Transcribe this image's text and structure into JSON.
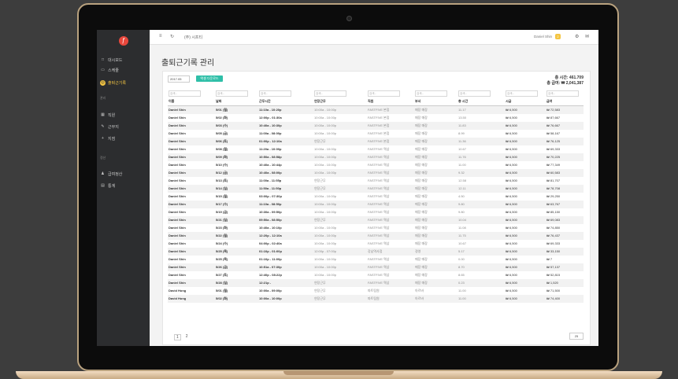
{
  "sidebar": {
    "items": [
      {
        "icon": "□",
        "label": "대시보드"
      },
      {
        "icon": "▭",
        "label": "스케줄"
      },
      {
        "icon": "◎",
        "label": "출퇴근기록"
      }
    ],
    "section1": "관리",
    "items2": [
      {
        "icon": "▦",
        "label": "직원"
      },
      {
        "icon": "✎",
        "label": "근무지"
      },
      {
        "icon": "+",
        "label": "지점"
      }
    ],
    "section2": "정산",
    "items3": [
      {
        "icon": "♟",
        "label": "급여정산"
      },
      {
        "icon": "▤",
        "label": "통계"
      }
    ]
  },
  "topbar": {
    "brand": "(주) 시프티",
    "user": "Daniel Shin",
    "badge": "2"
  },
  "page": {
    "title": "출퇴근기록 관리"
  },
  "toolbar": {
    "month": "2017.05",
    "button": "엑셀 다운로드"
  },
  "summary": {
    "line1": "총 시간: 461.709",
    "line2": "총 급여: ₩ 2,041,387"
  },
  "table": {
    "filter_placeholder": "검색...",
    "headers": [
      "이름",
      "날짜",
      "근무시간",
      "연장근무",
      "직원",
      "부서",
      "총 시간",
      "시급",
      "급여"
    ],
    "rows": [
      [
        "Daniel Shin",
        "5/01 (월)",
        "11:10a - 10:20p",
        "10:00a - 10:00p",
        "FASTFIVE 본점",
        "매장 매장",
        "11.17",
        "₩ 6,500",
        "₩ 72,583"
      ],
      [
        "Daniel Shin",
        "5/02 (화)",
        "12:00p - 01:30a",
        "10:00a - 10:00p",
        "FASTFIVE 본점",
        "매장 매장",
        "13.50",
        "₩ 6,500",
        "₩ 87,667"
      ],
      [
        "Daniel Shin",
        "5/03 (수)",
        "10:40a - 10:30p",
        "10:00a - 10:00p",
        "FASTFIVE 본점",
        "매장 매장",
        "11.83",
        "₩ 6,500",
        "₩ 76,667"
      ],
      [
        "Daniel Shin",
        "5/05 (금)",
        "11:00a - 08:00p",
        "10:00a - 10:00p",
        "FASTFIVE 본점",
        "매장 매장",
        "8.99",
        "₩ 6,500",
        "₩ 58,167"
      ],
      [
        "Daniel Shin",
        "5/06 (토)",
        "01:00p - 12:10a",
        "연장근무",
        "FASTFIVE 본점",
        "매장 매장",
        "11.36",
        "₩ 6,500",
        "₩ 76,125"
      ],
      [
        "Daniel Shin",
        "5/08 (월)",
        "11:20a - 10:00p",
        "10:00a - 10:00p",
        "FASTFIVE 역삼",
        "매장 매장",
        "10.67",
        "₩ 6,500",
        "₩ 69,333"
      ],
      [
        "Daniel Shin",
        "5/09 (화)",
        "10:50a - 08:58p",
        "10:00a - 10:00p",
        "FASTFIVE 역삼",
        "매장 매장",
        "11.76",
        "₩ 6,500",
        "₩ 70,225"
      ],
      [
        "Daniel Shin",
        "5/10 (수)",
        "10:40a - 10:44p",
        "10:00a - 10:00p",
        "FASTFIVE 역삼",
        "매장 매장",
        "11.00",
        "₩ 6,500",
        "₩ 77,349"
      ],
      [
        "Daniel Shin",
        "5/12 (금)",
        "10:40a - 08:00p",
        "10:00a - 10:00p",
        "FASTFIVE 역삼",
        "매장 매장",
        "9.32",
        "₩ 6,500",
        "₩ 60,583"
      ],
      [
        "Daniel Shin",
        "5/13 (토)",
        "11:00a - 11:55p",
        "연장근무",
        "FASTFIVE 역삼",
        "매장 매장",
        "12.58",
        "₩ 6,500",
        "₩ 81,707"
      ],
      [
        "Daniel Shin",
        "5/14 (일)",
        "11:50a - 11:50p",
        "연장근무",
        "FASTFIVE 역삼",
        "매장 매장",
        "12.11",
        "₩ 6,500",
        "₩ 78,708"
      ],
      [
        "Daniel Shin",
        "5/15 (월)",
        "03:00p - 07:30p",
        "10:00a - 10:00p",
        "FASTFIVE 역삼",
        "매장 매장",
        "4.50",
        "₩ 6,500",
        "₩ 29,250"
      ],
      [
        "Daniel Shin",
        "5/17 (수)",
        "11:10a - 08:50p",
        "10:00a - 10:00p",
        "FASTFIVE 역삼",
        "매장 매장",
        "9.80",
        "₩ 6,500",
        "₩ 63,767"
      ],
      [
        "Daniel Shin",
        "5/19 (금)",
        "10:30a - 09:50p",
        "10:00a - 10:00p",
        "FASTFIVE 역삼",
        "매장 매장",
        "9.80",
        "₩ 6,500",
        "₩ 85,150"
      ],
      [
        "Daniel Shin",
        "5/21 (일)",
        "09:50a - 08:50p",
        "연장근무",
        "FASTFIVE 역삼",
        "매장 매장",
        "10.04",
        "₩ 6,500",
        "₩ 69,083"
      ],
      [
        "Daniel Shin",
        "5/23 (화)",
        "10:40a - 10:10p",
        "10:00a - 10:00p",
        "FASTFIVE 역삼",
        "매장 매장",
        "11.08",
        "₩ 6,500",
        "₩ 74,850"
      ],
      [
        "Daniel Shin",
        "5/22 (월)",
        "12:20p - 12:10a",
        "10:00a - 10:00p",
        "FASTFIVE 역삼",
        "매장 매장",
        "11.75",
        "₩ 6,500",
        "₩ 76,437"
      ],
      [
        "Daniel Shin",
        "5/24 (수)",
        "04:00p - 02:40a",
        "10:00a - 10:00p",
        "FASTFIVE 역삼",
        "매장 매장",
        "10.67",
        "₩ 6,500",
        "₩ 69,333"
      ],
      [
        "Daniel Shin",
        "5/25 (목)",
        "01:10p - 01:00p",
        "12:00p - 07:00p",
        "강남역사점",
        "경영",
        "5.17",
        "₩ 6,500",
        "₩ 33,150"
      ],
      [
        "Daniel Shin",
        "5/25 (목)",
        "01:10p - 11:00p",
        "10:00a - 10:00p",
        "FASTFIVE 역삼",
        "매장 매장",
        "0.00",
        "₩ 6,500",
        "₩ 7"
      ],
      [
        "Daniel Shin",
        "5/26 (금)",
        "10:51a - 07:30p",
        "10:00a - 10:00p",
        "FASTFIVE 역삼",
        "매장 매장",
        "8.70",
        "₩ 6,500",
        "₩ 57,137"
      ],
      [
        "Daniel Shin",
        "5/27 (토)",
        "12:40p - 08:22p",
        "10:00a - 10:00p",
        "FASTFIVE 역삼",
        "매장 매장",
        "8.65",
        "₩ 6,500",
        "₩ 52,815"
      ],
      [
        "Daniel Shin",
        "5/28 (일)",
        "12:21p -",
        "연장근무",
        "FASTFIVE 역삼",
        "매장 매장",
        "0.23",
        "₩ 6,500",
        "₩ 1,520"
      ],
      [
        "David Hong",
        "5/01 (월)",
        "10:00a - 09:00p",
        "연장근무",
        "파트팀원",
        "아르바",
        "11.00",
        "₩ 6,500",
        "₩ 71,500"
      ],
      [
        "David Hong",
        "5/02 (화)",
        "10:00a - 10:00p",
        "연장근무",
        "파트팀원",
        "아르바",
        "11.00",
        "₩ 6,500",
        "₩ 74,400"
      ]
    ]
  },
  "pager": {
    "prev": "1",
    "next": "2",
    "page_size": "25"
  },
  "colors": {
    "accent": "#2fbfa8",
    "sidebar_active": "#f4c542",
    "brand_red": "#e8473c"
  }
}
